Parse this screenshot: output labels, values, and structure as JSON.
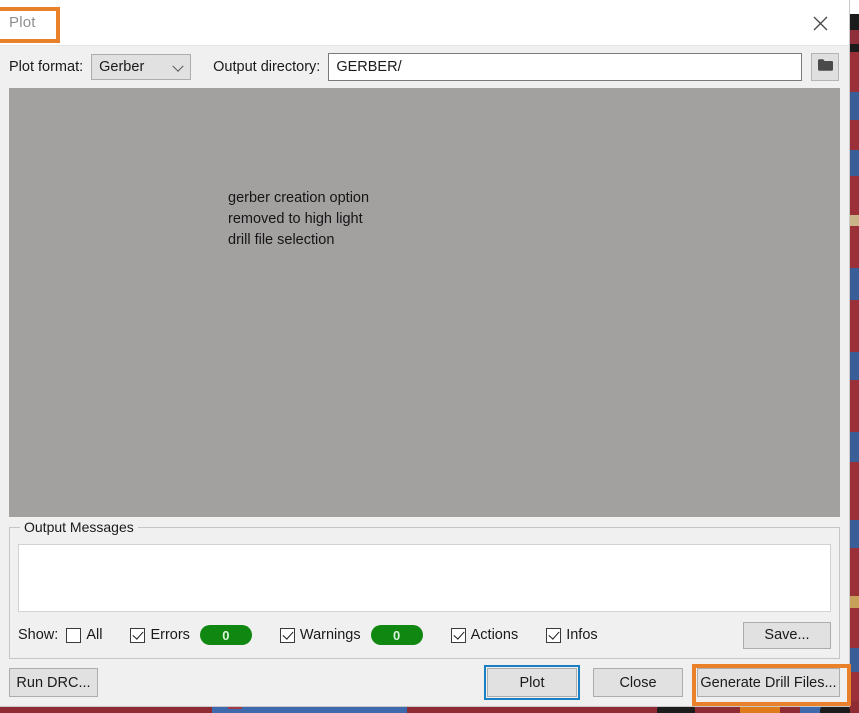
{
  "window": {
    "title": "Plot",
    "close_icon": "close-icon"
  },
  "toolbar": {
    "plot_format_label": "Plot format:",
    "plot_format_value": "Gerber",
    "plot_format_options": [
      "Gerber"
    ],
    "output_dir_label": "Output directory:",
    "output_dir_value": "GERBER/",
    "output_dir_placeholder": "",
    "browse_icon": "folder-icon"
  },
  "panel": {
    "annotation_note": "gerber creation option\nremoved to high light\ndrill file selection"
  },
  "output_messages": {
    "legend": "Output Messages",
    "body_text": "",
    "show_label": "Show:",
    "filters": [
      {
        "label": "All",
        "checked": false,
        "badge": null
      },
      {
        "label": "Errors",
        "checked": true,
        "badge": "0"
      },
      {
        "label": "Warnings",
        "checked": true,
        "badge": "0"
      },
      {
        "label": "Actions",
        "checked": true,
        "badge": null
      },
      {
        "label": "Infos",
        "checked": true,
        "badge": null
      }
    ],
    "save_label": "Save..."
  },
  "buttons": {
    "run_drc": "Run DRC...",
    "plot": "Plot",
    "close": "Close",
    "generate_drill_files": "Generate Drill Files..."
  },
  "colors": {
    "accent_highlight": "#e8812a",
    "focus_ring": "#1a7fc1",
    "badge_green": "#0f8711",
    "panel_gray": "#a3a0a0",
    "dialog_bg": "#f0f0f0"
  }
}
